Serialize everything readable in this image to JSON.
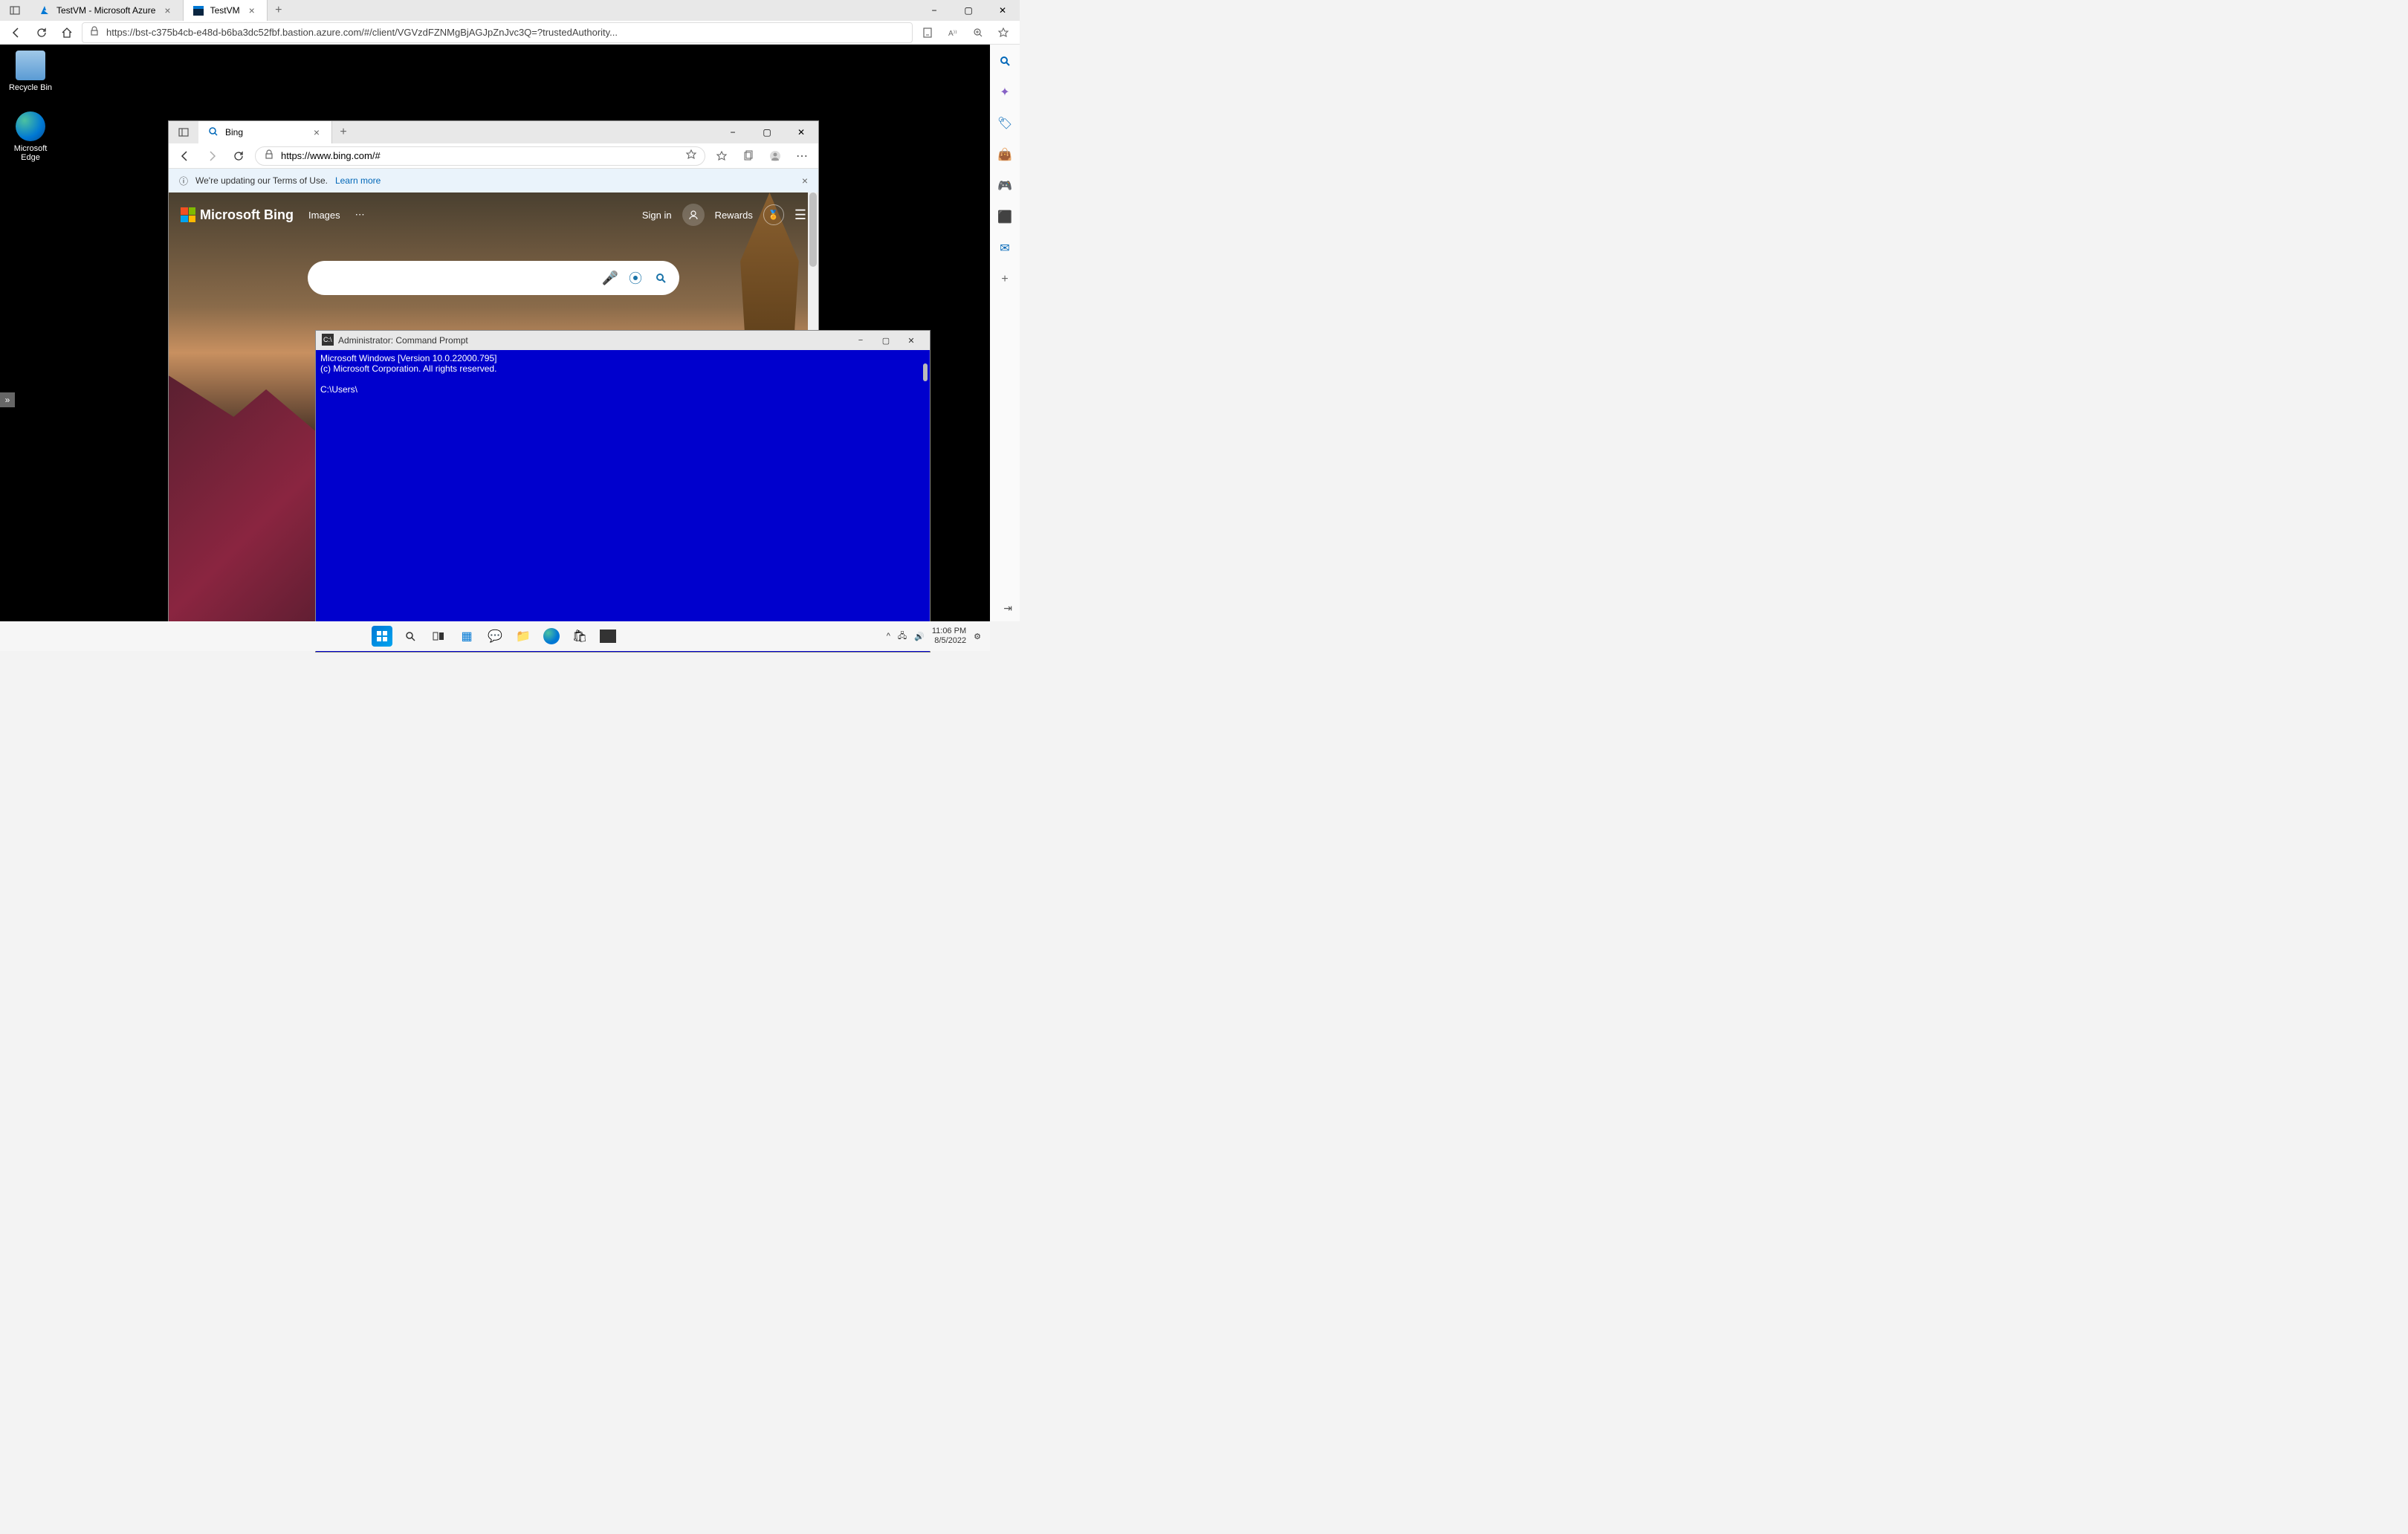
{
  "outer": {
    "tabs": [
      {
        "title": "TestVM  - Microsoft Azure"
      },
      {
        "title": "TestVM"
      }
    ],
    "url": "https://bst-c375b4cb-e48d-b6ba3dc52fbf.bastion.azure.com/#/client/VGVzdFZNMgBjAGJpZnJvc3Q=?trustedAuthority..."
  },
  "desktop": {
    "recycle": "Recycle Bin",
    "edge": "Microsoft Edge"
  },
  "innerEdge": {
    "tab": "Bing",
    "url": "https://www.bing.com/#",
    "info": "We're updating our Terms of Use.",
    "learn": "Learn more",
    "bing": {
      "brand": "Microsoft Bing",
      "images": "Images",
      "signin": "Sign in",
      "rewards": "Rewards",
      "searchPlaceholder": ""
    }
  },
  "cmd": {
    "title": "Administrator: Command Prompt",
    "line1": "Microsoft Windows [Version 10.0.22000.795]",
    "line2": "(c) Microsoft Corporation. All rights reserved.",
    "prompt": "C:\\Users\\"
  },
  "taskbar": {
    "time": "11:06 PM",
    "date": "8/5/2022"
  }
}
